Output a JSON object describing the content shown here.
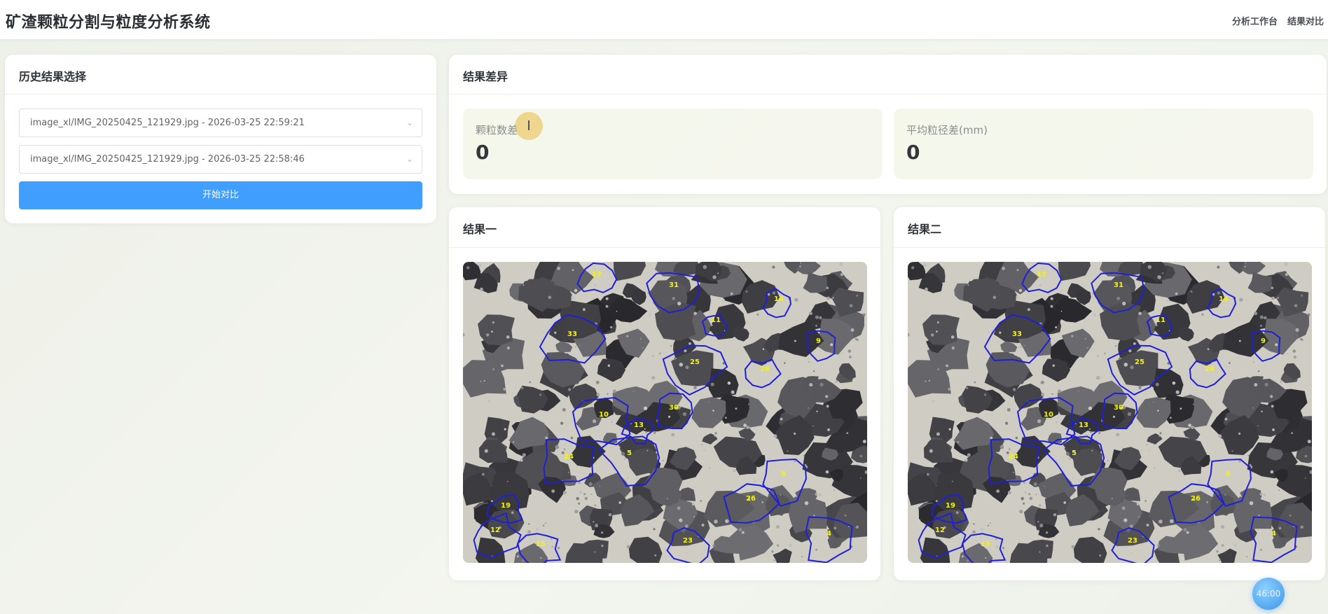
{
  "header": {
    "title": "矿渣颗粒分割与粒度分析系统",
    "nav": [
      {
        "label": "分析工作台"
      },
      {
        "label": "结果对比"
      }
    ]
  },
  "history": {
    "title": "历史结果选择",
    "select_one": "image_xl/IMG_20250425_121929.jpg - 2026-03-25 22:59:21",
    "select_two": "image_xl/IMG_20250425_121929.jpg - 2026-03-25 22:58:46",
    "compare_button": "开始对比"
  },
  "diff": {
    "title": "结果差异",
    "particle_count_label": "颗粒数差",
    "particle_count_value": "0",
    "mean_size_label": "平均粒径差(mm)",
    "mean_size_value": "0"
  },
  "results": {
    "one_title": "结果一",
    "two_title": "结果二"
  },
  "float_timer": "46:00",
  "colors": {
    "primary": "#409eff",
    "contour": "#1f1fd8",
    "label": "#f5f500"
  },
  "particle_labels": [
    "17",
    "31",
    "11",
    "14",
    "9",
    "25",
    "28",
    "10",
    "13",
    "30",
    "24",
    "19",
    "12",
    "15",
    "23",
    "5",
    "26",
    "6",
    "4",
    "33"
  ]
}
